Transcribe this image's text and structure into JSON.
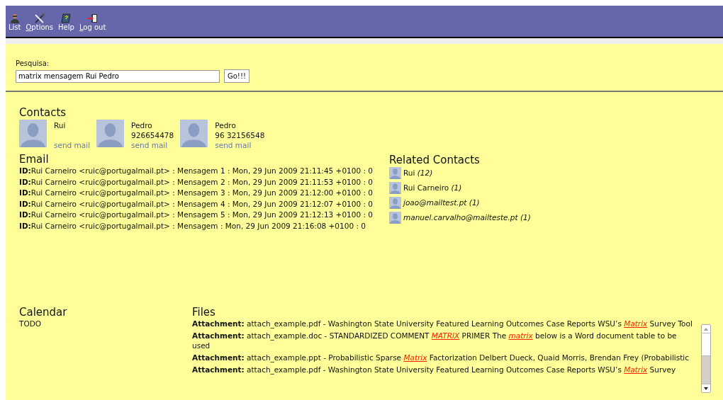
{
  "toolbar": [
    {
      "label": "List",
      "kind": "list"
    },
    {
      "label": "ptions",
      "kind": "options",
      "underline": "O"
    },
    {
      "label": "Help",
      "kind": "help"
    },
    {
      "label": "og out",
      "kind": "logout",
      "underline": "L"
    }
  ],
  "search": {
    "label": "Pesquisa:",
    "value": "matrix mensagem Rui Pedro",
    "button": "Go!!!"
  },
  "contacts": {
    "title": "Contacts",
    "items": [
      {
        "name": "Rui",
        "link": "send mail"
      },
      {
        "name": "Pedro",
        "phone": "926654478",
        "link": "send mail"
      },
      {
        "name": "Pedro",
        "phone": "96 32156548",
        "link": "send mail"
      }
    ]
  },
  "email": {
    "title": "Email",
    "rows": [
      "**ID:**Rui Carneiro <ruic@portugalmail.pt> : Mensagem 1 : Mon, 29 Jun 2009 21:11:45 +0100 : 0",
      "**ID:**Rui Carneiro <ruic@portugalmail.pt> : Mensagem 2 : Mon, 29 Jun 2009 21:11:53 +0100 : 0",
      "**ID:**Rui Carneiro <ruic@portugalmail.pt> : Mensagem 3 : Mon, 29 Jun 2009 21:12:00 +0100 : 0",
      "**ID:**Rui Carneiro <ruic@portugalmail.pt> : Mensagem 4 : Mon, 29 Jun 2009 21:12:07 +0100 : 0",
      "**ID:**Rui Carneiro <ruic@portugalmail.pt> : Mensagem 5 : Mon, 29 Jun 2009 21:12:13 +0100 : 0",
      "**ID:**Rui Carneiro <ruic@portugalmail.pt> : Mensagem : Mon, 29 Jun 2009 21:16:08 +0100 : 0"
    ]
  },
  "related_contacts": {
    "title": "Related Contacts",
    "items": [
      "Rui *(12)*",
      "Rui Carneiro *(1)*",
      "*joao@mailtest.pt (1)*",
      "*manuel.carvalho@mailteste.pt (1)*"
    ]
  },
  "calendar": {
    "title": "Calendar",
    "text": "TODO"
  },
  "files": {
    "title": "Files",
    "items": [
      "**Attachment:** attach_example.pdf - Washington State University Featured Learning Outcomes Case Reports WSU’s *Matrix* Survey Tool",
      "**Attachment:** attach_example.doc - STANDARDIZED COMMENT *MATRIX* PRIMER The *matrix* below is a Word document table to be used",
      "**Attachment:** attach_example.ppt - Probabilistic Sparse *Matrix* Factorization Delbert Dueck, Quaid Morris, Brendan Frey (Probabilistic",
      "**Attachment:** attach_example.pdf - Washington State University Featured Learning Outcomes Case Reports WSU’s *Matrix* Survey"
    ]
  }
}
